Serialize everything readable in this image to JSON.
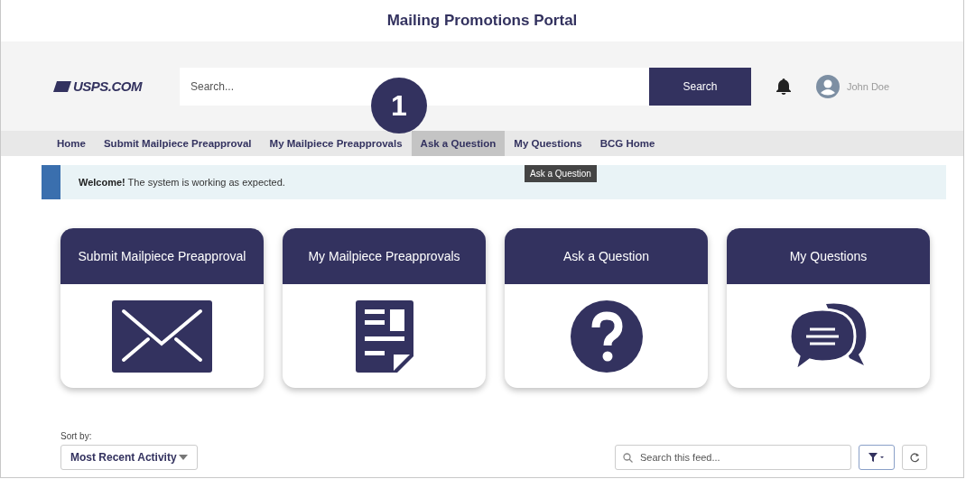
{
  "window": {
    "title": "Mailing Promotions Portal"
  },
  "header": {
    "logo": "USPS.COM",
    "search": {
      "placeholder": "Search..."
    },
    "search_button": "Search",
    "user": "John Doe"
  },
  "step_badge": "1",
  "nav": [
    {
      "label": "Home",
      "selected": false
    },
    {
      "label": "Submit Mailpiece Preapproval",
      "selected": false
    },
    {
      "label": "My Mailpiece Preapprovals",
      "selected": false
    },
    {
      "label": "Ask a Question",
      "selected": true
    },
    {
      "label": "My Questions",
      "selected": false
    },
    {
      "label": "BCG Home",
      "selected": false
    }
  ],
  "tooltip": "Ask a Question",
  "banner": {
    "text": "**Welcome!** The system is working as expected."
  },
  "cards": [
    {
      "title": "Submit Mailpiece Preapproval",
      "kind": "mail"
    },
    {
      "title": "My Mailpiece Preapprovals",
      "kind": "document"
    },
    {
      "title": "Ask a Question",
      "kind": "question"
    },
    {
      "title": "My Questions",
      "kind": "chat"
    }
  ],
  "feed": {
    "sort_label": "Sort by:",
    "sort_value": "Most Recent Activity",
    "search": {
      "placeholder": "Search this feed..."
    }
  }
}
